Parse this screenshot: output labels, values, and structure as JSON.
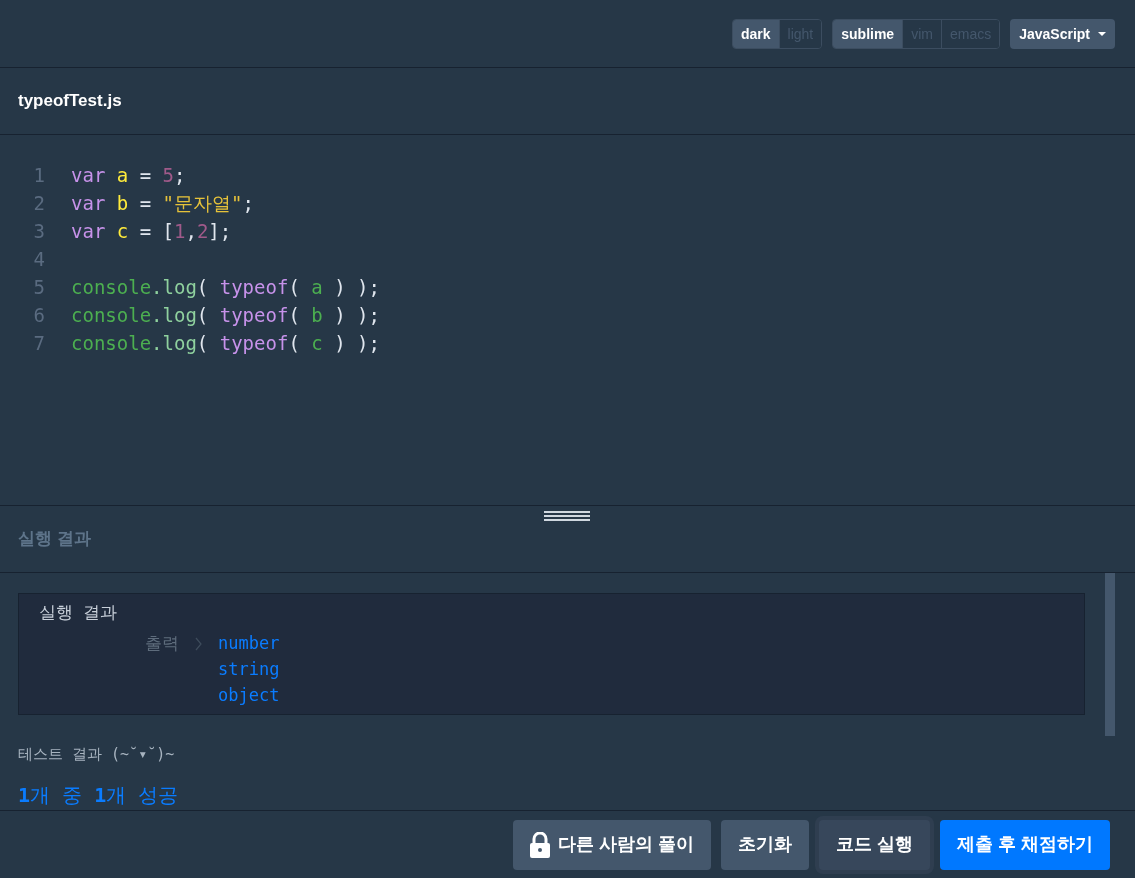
{
  "toolbar": {
    "themes": [
      {
        "label": "dark",
        "selected": true
      },
      {
        "label": "light",
        "selected": false
      }
    ],
    "keymaps": [
      {
        "label": "sublime",
        "selected": true
      },
      {
        "label": "vim",
        "selected": false
      },
      {
        "label": "emacs",
        "selected": false
      }
    ],
    "language": "JavaScript"
  },
  "file_tab": "typeofTest.js",
  "editor": {
    "lines": [
      {
        "number": "1",
        "tokens": [
          {
            "kind": "keyword",
            "text": "var"
          },
          {
            "kind": "variable",
            "text": " a"
          },
          {
            "kind": "plain",
            "text": " = "
          },
          {
            "kind": "number",
            "text": "5"
          },
          {
            "kind": "plain",
            "text": ";"
          }
        ]
      },
      {
        "number": "2",
        "tokens": [
          {
            "kind": "keyword",
            "text": "var"
          },
          {
            "kind": "variable",
            "text": " b"
          },
          {
            "kind": "plain",
            "text": " = "
          },
          {
            "kind": "string",
            "text": "\"문자열\""
          },
          {
            "kind": "plain",
            "text": ";"
          }
        ]
      },
      {
        "number": "3",
        "tokens": [
          {
            "kind": "keyword",
            "text": "var"
          },
          {
            "kind": "variable",
            "text": " c"
          },
          {
            "kind": "plain",
            "text": " = ["
          },
          {
            "kind": "number",
            "text": "1"
          },
          {
            "kind": "plain",
            "text": ","
          },
          {
            "kind": "number",
            "text": "2"
          },
          {
            "kind": "plain",
            "text": "];"
          }
        ]
      },
      {
        "number": "4"
      },
      {
        "number": "5",
        "tokens": [
          {
            "kind": "builtin",
            "text": "console"
          },
          {
            "kind": "method",
            "text": ".log"
          },
          {
            "kind": "plain",
            "text": "( "
          },
          {
            "kind": "keyword",
            "text": "typeof"
          },
          {
            "kind": "plain",
            "text": "( "
          },
          {
            "kind": "builtin",
            "text": "a"
          },
          {
            "kind": "plain",
            "text": " ) );"
          }
        ]
      },
      {
        "number": "6",
        "tokens": [
          {
            "kind": "builtin",
            "text": "console"
          },
          {
            "kind": "method",
            "text": ".log"
          },
          {
            "kind": "plain",
            "text": "( "
          },
          {
            "kind": "keyword",
            "text": "typeof"
          },
          {
            "kind": "plain",
            "text": "( "
          },
          {
            "kind": "builtin",
            "text": "b"
          },
          {
            "kind": "plain",
            "text": " ) );"
          }
        ]
      },
      {
        "number": "7",
        "tokens": [
          {
            "kind": "builtin",
            "text": "console"
          },
          {
            "kind": "method",
            "text": ".log"
          },
          {
            "kind": "plain",
            "text": "( "
          },
          {
            "kind": "keyword",
            "text": "typeof"
          },
          {
            "kind": "plain",
            "text": "( "
          },
          {
            "kind": "builtin",
            "text": "c"
          },
          {
            "kind": "plain",
            "text": " ) );"
          }
        ]
      }
    ]
  },
  "results": {
    "header": "실행 결과",
    "box_title": "실행 결과",
    "output_label": "출력",
    "output_lines": [
      "number",
      "string",
      "object"
    ],
    "test_title": "테스트 결과 (~˘▾˘)~",
    "summary": "**1**개 중 **1**개 성공"
  },
  "buttons": [
    {
      "kind": "locked",
      "label": "다른 사람의 풀이"
    },
    {
      "kind": "secondary",
      "label": "초기화"
    },
    {
      "kind": "outlined",
      "label": "코드 실행"
    },
    {
      "kind": "primary",
      "label": "제출 후 채점하기"
    }
  ]
}
